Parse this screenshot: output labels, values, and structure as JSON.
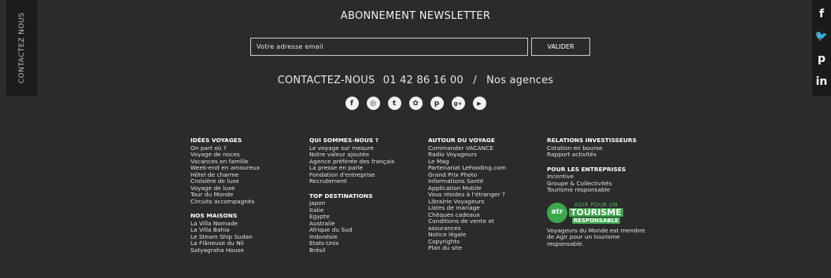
{
  "side_tab": {
    "label": "CONTACTEZ NOUS"
  },
  "social_rail": [
    {
      "icon": "facebook-icon",
      "glyph": "f"
    },
    {
      "icon": "twitter-icon",
      "glyph": "🐦"
    },
    {
      "icon": "pinterest-icon",
      "glyph": "p"
    },
    {
      "icon": "linkedin-icon",
      "glyph": "in"
    }
  ],
  "newsletter": {
    "title": "ABONNEMENT NEWSLETTER",
    "placeholder": "Votre adresse email",
    "button": "VALIDER"
  },
  "contact": {
    "label": "CONTACTEZ-NOUS",
    "phone": "01 42 86 16 00",
    "separator": "/",
    "agencies": "Nos agences"
  },
  "circle_icons": [
    {
      "icon": "facebook-icon",
      "glyph": "f"
    },
    {
      "icon": "instagram-icon",
      "glyph": "◎"
    },
    {
      "icon": "twitter-icon",
      "glyph": "t"
    },
    {
      "icon": "podcast-icon",
      "glyph": "✿"
    },
    {
      "icon": "pinterest-icon",
      "glyph": "p"
    },
    {
      "icon": "googleplus-icon",
      "glyph": "g+"
    },
    {
      "icon": "youtube-icon",
      "glyph": "▶"
    }
  ],
  "columns": [
    {
      "blocks": [
        {
          "heading": "IDÉES VOYAGES",
          "links": [
            "On part où ?",
            "Voyage de noces",
            "Vacances en famille",
            "Week-end en amoureux",
            "Hôtel de charme",
            "Croisière de luxe",
            "Voyage de luxe",
            "Tour du Monde",
            "Circuits accompagnés"
          ]
        },
        {
          "heading": "NOS MAISONS",
          "links": [
            "La Villa Nomade",
            "La Villa Bahia",
            "Le Steam Ship Sudan",
            "La Flâneuse du Nil",
            "Satyagraha House"
          ]
        }
      ]
    },
    {
      "blocks": [
        {
          "heading": "QUI SOMMES-NOUS ?",
          "links": [
            "Le voyage sur mesure",
            "Notre valeur ajoutée",
            "Agence préférée des français",
            "La presse en parle",
            "Fondation d'entreprise",
            "Recrutement"
          ]
        },
        {
          "heading": "TOP DESTINATIONS",
          "links": [
            "Japon",
            "Italie",
            "Egypte",
            "Australie",
            "Afrique du Sud",
            "Indonésie",
            "Etats-Unis",
            "Brésil"
          ]
        }
      ]
    },
    {
      "blocks": [
        {
          "heading": "AUTOUR DU VOYAGE",
          "links": [
            "Commander VACANCE",
            "Radio Voyageurs",
            "Le Mag",
            "Partenariat LeFooding.com",
            "Grand Prix Photo",
            "Informations Santé",
            "Application Mobile",
            "Vous résidez à l'étranger ?",
            "Librairie Voyageurs",
            "Listes de mariage",
            "Chèques cadeaux",
            "Conditions de vente et",
            "assurances",
            "Notice légale",
            "Copyrights",
            "Plan du site"
          ]
        }
      ]
    },
    {
      "blocks": [
        {
          "heading": "RELATIONS INVESTISSEURS",
          "links": [
            "Cotation en bourse",
            "Rapport activités"
          ]
        },
        {
          "heading": "POUR LES ENTREPRISES",
          "links": [
            "Incentive",
            "Groupe & Collectivités",
            "Tourisme responsable"
          ]
        }
      ],
      "atr": {
        "badge": "atr",
        "top": "AGIR POUR UN",
        "mid": "TOURISME",
        "bot": "RESPONSABLE",
        "caption": [
          "Voyageurs du Monde est membre",
          "de Agir pour un tourisme",
          "responsable."
        ]
      }
    }
  ]
}
